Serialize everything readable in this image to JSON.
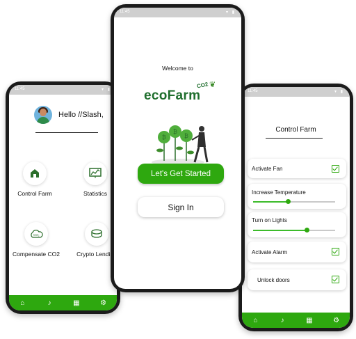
{
  "status_time": "11:45",
  "status_icons": "▾ ▮",
  "accent_color": "#2ea80f",
  "left_screen": {
    "greeting": "Hello //Slash,",
    "tiles": [
      {
        "label": "Control Farm",
        "icon": "barn-icon"
      },
      {
        "label": "Statistics",
        "icon": "chart-board-icon"
      },
      {
        "label": "Compensate CO2",
        "icon": "co2-cloud-icon"
      },
      {
        "label": "Crypto Lending",
        "icon": "coins-icon"
      }
    ]
  },
  "center_screen": {
    "welcome": "Welcome to",
    "brand": "ecoFarm",
    "brand_sub": "CO2",
    "start_label": "Let's Get Started",
    "signin_label": "Sign In"
  },
  "right_screen": {
    "title": "Control Farm",
    "items": [
      {
        "label": "Activate Fan",
        "type": "checkbox"
      },
      {
        "label": "Increase Temperature",
        "type": "slider",
        "level": 0.42
      },
      {
        "label": "Turn on Lights",
        "type": "slider",
        "level": 0.65
      },
      {
        "label": "Activate Alarm",
        "type": "checkbox"
      },
      {
        "label": "Unlock doors",
        "type": "checkbox"
      }
    ]
  },
  "nav_icons": [
    "home-icon",
    "bell-icon",
    "calendar-icon",
    "gear-icon"
  ]
}
